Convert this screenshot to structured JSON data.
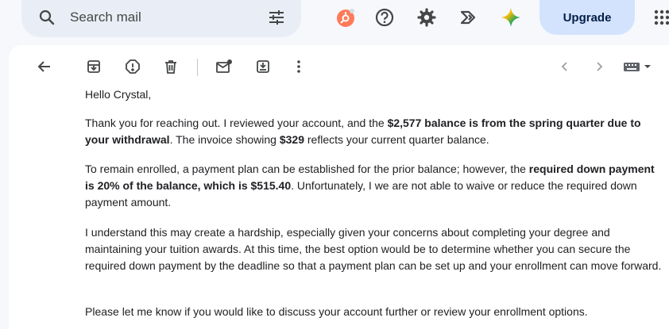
{
  "search": {
    "placeholder": "Search mail"
  },
  "header": {
    "upgrade_label": "Upgrade"
  },
  "email": {
    "greeting": "Hello Crystal,",
    "p1": {
      "t1": "Thank you for reaching out. I reviewed your account, and the ",
      "b1": "$2,577 balance is from the spring quarter due to your withdrawal",
      "t2": ". The invoice showing ",
      "b2": "$329",
      "t3": " reflects your current quarter balance."
    },
    "p2": {
      "t1": "To remain enrolled, a payment plan can be established for the prior balance; however, the ",
      "b1": "required down payment is 20% of the balance, which is $515.40",
      "t2": ". Unfortunately, I we are not able to waive or reduce the required down payment amount."
    },
    "p3": "I understand this may create a hardship, especially given your concerns about completing your degree and maintaining your tuition awards. At this time, the best option would be to determine whether you can secure the required down payment by the deadline so that a payment plan can be set up and your enrollment can move forward.",
    "p4": "Please let me know if you would like to discuss your account further or review your enrollment options."
  }
}
